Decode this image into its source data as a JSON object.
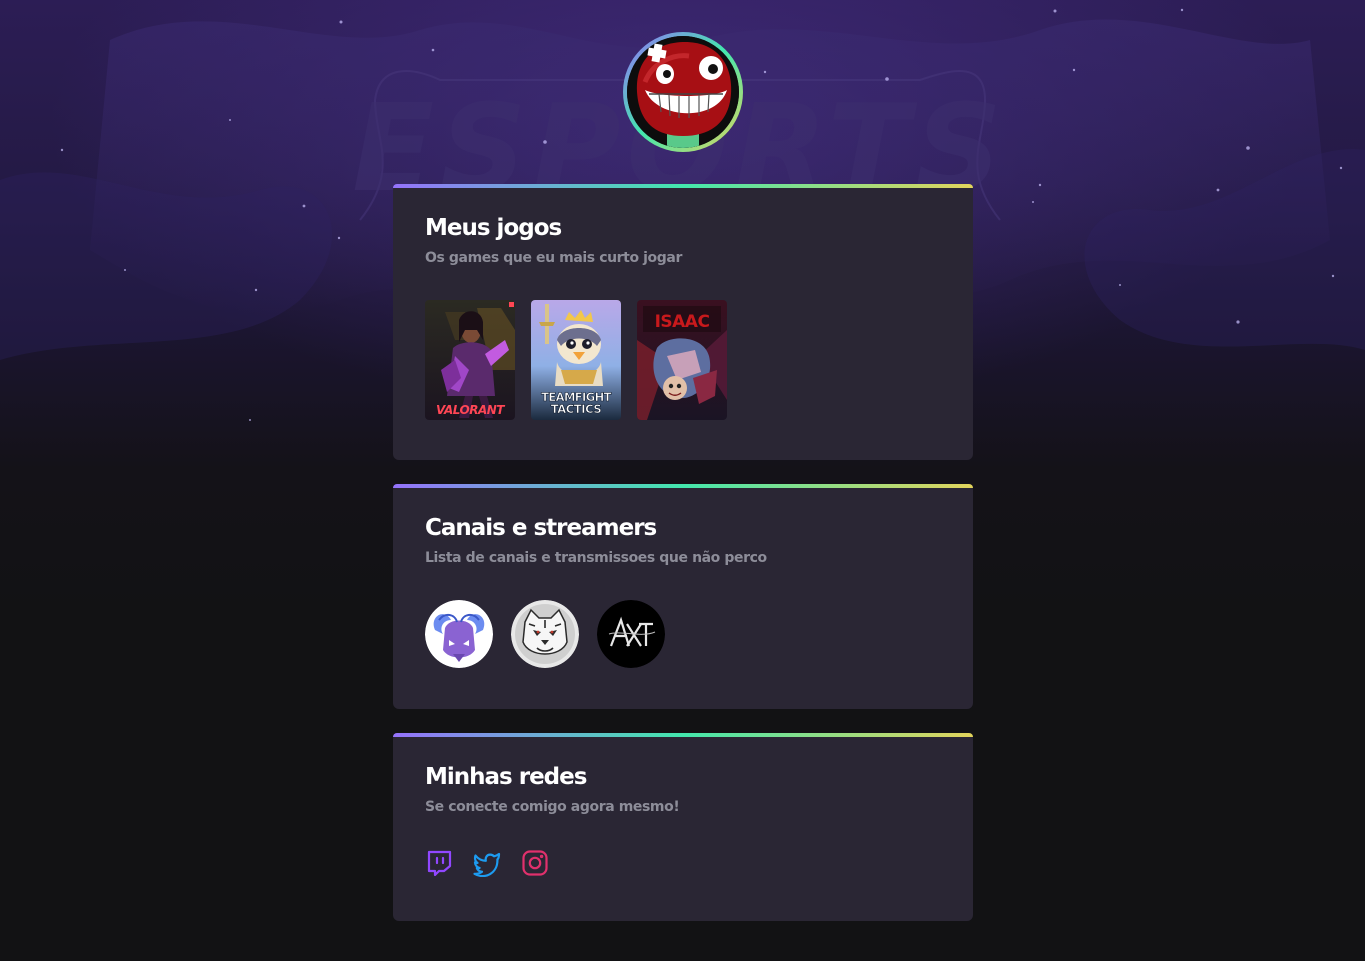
{
  "profile": {
    "avatar_icon": "super-meat-boy-avatar"
  },
  "background": {
    "watermark_text": "ESPORTS"
  },
  "games_section": {
    "title": "Meus jogos",
    "subtitle": "Os games que eu mais curto jogar",
    "games": [
      {
        "name": "VALORANT",
        "caption": "VALORANT"
      },
      {
        "name": "Teamfight Tactics",
        "caption_line1": "TEAMFIGHT",
        "caption_line2": "TACTICS"
      },
      {
        "name": "The Binding of Isaac",
        "caption": "ISAAC"
      }
    ]
  },
  "channels_section": {
    "title": "Canais e streamers",
    "subtitle": "Lista de canais e transmissoes que não perco",
    "channels": [
      {
        "icon": "purple-ram-avatar"
      },
      {
        "icon": "white-tiger-avatar"
      },
      {
        "icon": "axt-logo-avatar"
      }
    ]
  },
  "social_section": {
    "title": "Minhas redes",
    "subtitle": "Se conecte comigo agora mesmo!",
    "links": [
      {
        "icon": "twitch-icon",
        "color": "#9147ff"
      },
      {
        "icon": "twitter-icon",
        "color": "#1d9bf0"
      },
      {
        "icon": "instagram-icon",
        "color": "#e1306c"
      }
    ]
  },
  "colors": {
    "gradient_start": "#9572fc",
    "gradient_mid": "#43e7ad",
    "gradient_end": "#e2d45c",
    "card_bg": "#2a2634",
    "page_bg": "#121214"
  }
}
